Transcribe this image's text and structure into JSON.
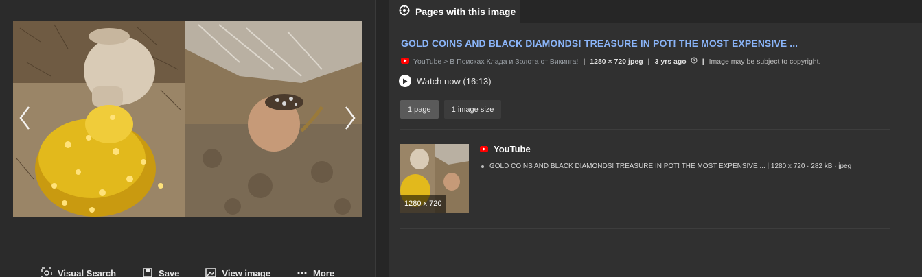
{
  "left": {
    "actions": [
      {
        "label": "Visual Search",
        "icon": "visual-search-icon"
      },
      {
        "label": "Save",
        "icon": "save-icon"
      },
      {
        "label": "View image",
        "icon": "view-image-icon"
      },
      {
        "label": "More",
        "icon": "more-icon"
      }
    ]
  },
  "right": {
    "tab_label": "Pages with this image",
    "result": {
      "title": "GOLD COINS AND BLACK DIAMONDS! TREASURE IN POT! THE MOST EXPENSIVE ...",
      "source": "YouTube > В Поисках Клада и Золота от Викинга!",
      "dimensions": "1280 × 720 jpeg",
      "age": "3 yrs ago",
      "copyright": "Image may be subject to copyright.",
      "watch_label": "Watch now (16:13)",
      "chips": [
        "1 page",
        "1 image size"
      ]
    },
    "page_item": {
      "thumb_label": "1280 x 720",
      "site": "YouTube",
      "detail": "GOLD COINS AND BLACK DIAMONDS! TREASURE IN POT! THE MOST EXPENSIVE ... | 1280 x 720 · 282 kB · jpeg"
    }
  },
  "colors": {
    "link": "#8ab4f8",
    "youtube_red": "#ff0000",
    "gold": "#e2b91c"
  }
}
